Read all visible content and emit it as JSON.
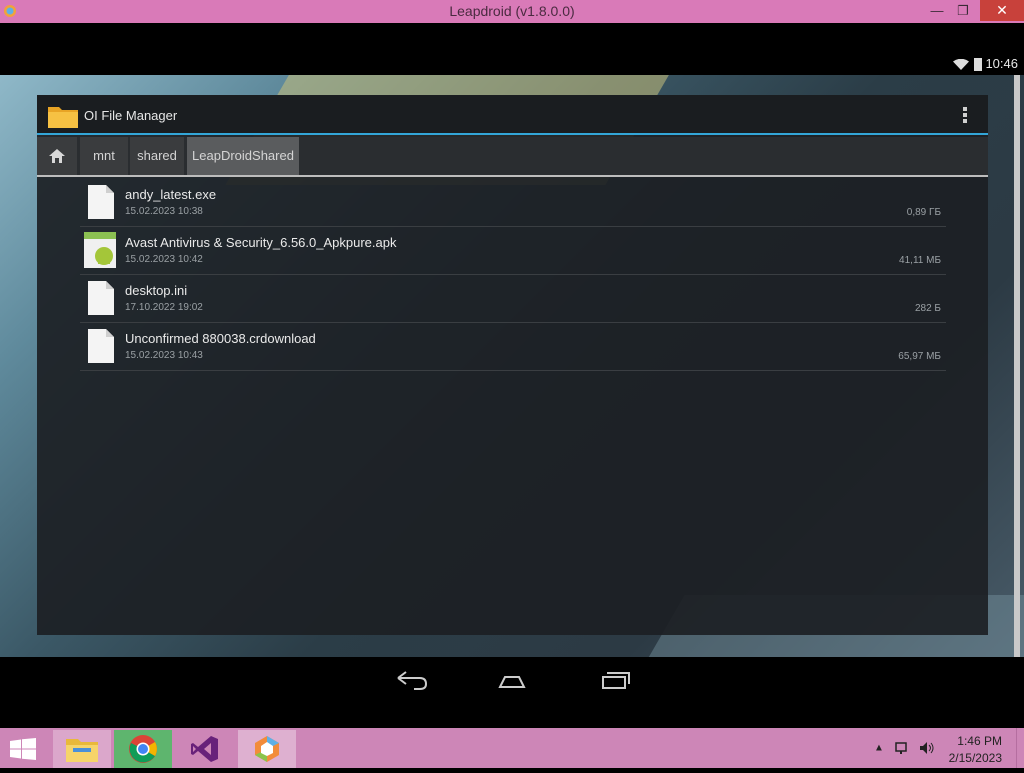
{
  "window": {
    "title": "Leapdroid (v1.8.0.0)",
    "minimize": "—",
    "maximize": "❐",
    "close": "✕"
  },
  "status_bar": {
    "time": "10:46"
  },
  "app": {
    "title": "OI File Manager"
  },
  "breadcrumb": {
    "items": [
      "mnt",
      "shared",
      "LeapDroidShared"
    ]
  },
  "files": [
    {
      "name": "andy_latest.exe",
      "date": "15.02.2023 10:38",
      "size": "0,89 ГБ",
      "icon": "file-icon"
    },
    {
      "name": "Avast Antivirus & Security_6.56.0_Apkpure.apk",
      "date": "15.02.2023 10:42",
      "size": "41,11 МБ",
      "icon": "apk-icon"
    },
    {
      "name": "desktop.ini",
      "date": "17.10.2022 19:02",
      "size": "282 Б",
      "icon": "file-icon"
    },
    {
      "name": "Unconfirmed 880038.crdownload",
      "date": "15.02.2023 10:43",
      "size": "65,97 МБ",
      "icon": "file-icon"
    }
  ],
  "taskbar": {
    "clock_time": "1:46 PM",
    "clock_date": "2/15/2023",
    "tray": "▲"
  },
  "colors": {
    "titlebar": "#d97ab8",
    "taskbar": "#cd86b7",
    "accent": "#33a6d8",
    "close": "#c8413b"
  }
}
